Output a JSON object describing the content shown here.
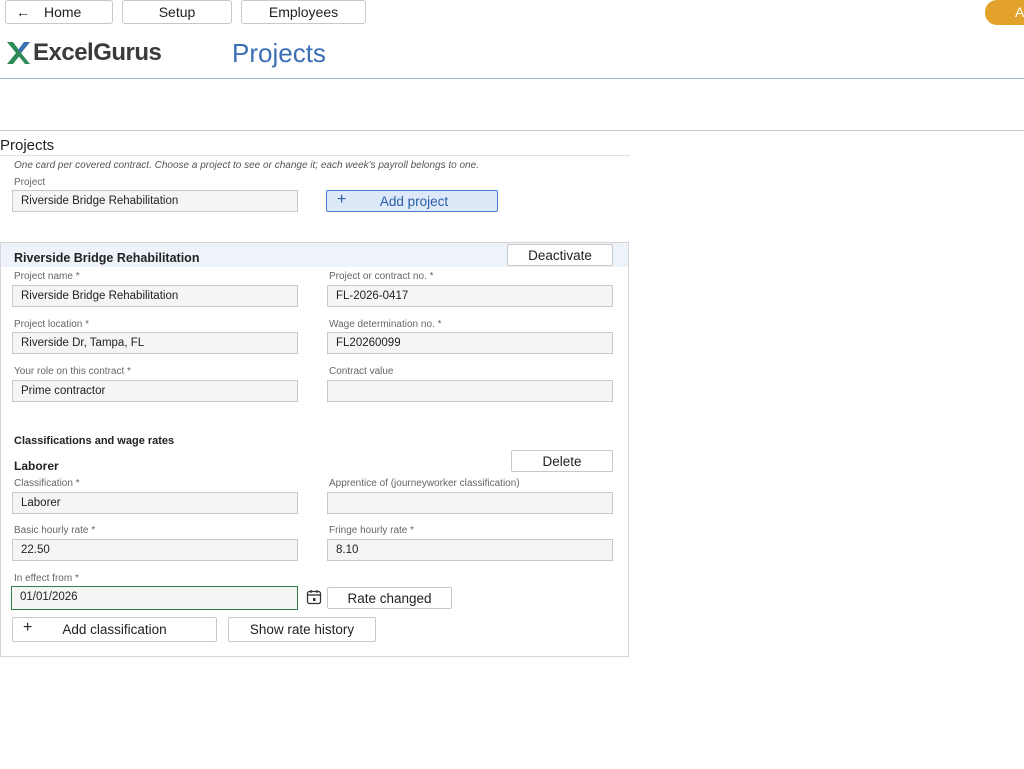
{
  "nav": {
    "home": "Home",
    "home_arrow": "←",
    "setup": "Setup",
    "employees": "Employees",
    "corner": "A"
  },
  "brand": {
    "logo_text": "ExcelGurus",
    "logo_mark": "X"
  },
  "page": {
    "title": "Projects"
  },
  "section": {
    "title": "Projects",
    "hint": "One card per covered contract. Choose a project to see or change it; each week's payroll belongs to one.",
    "project_label": "Project",
    "project_value": "Riverside Bridge Rehabilitation",
    "add_project": "Add project"
  },
  "card": {
    "title": "Riverside Bridge Rehabilitation",
    "deactivate": "Deactivate",
    "project_name_label": "Project name *",
    "project_name": "Riverside Bridge Rehabilitation",
    "contract_no_label": "Project or contract no. *",
    "contract_no": "FL-2026-0417",
    "location_label": "Project location *",
    "location": "Riverside Dr, Tampa, FL",
    "wage_det_label": "Wage determination no. *",
    "wage_det": "FL20260099",
    "role_label": "Your role on this contract *",
    "role": "Prime contractor",
    "contract_value_label": "Contract value",
    "contract_value": ""
  },
  "classifications": {
    "title": "Classifications and wage rates",
    "item_title": "Laborer",
    "delete": "Delete",
    "classification_label": "Classification *",
    "classification": "Laborer",
    "apprentice_label": "Apprentice of (journeyworker classification)",
    "apprentice": "",
    "basic_label": "Basic hourly rate *",
    "basic": "22.50",
    "fringe_label": "Fringe hourly rate *",
    "fringe": "8.10",
    "effective_label": "In effect from *",
    "effective": "01/01/2026",
    "rate_changed": "Rate changed",
    "add_classification": "Add classification",
    "show_history": "Show rate history"
  },
  "colors": {
    "accent": "#3b6fb6",
    "pill": "#e2a22c",
    "active_border": "#2e7d4a"
  }
}
